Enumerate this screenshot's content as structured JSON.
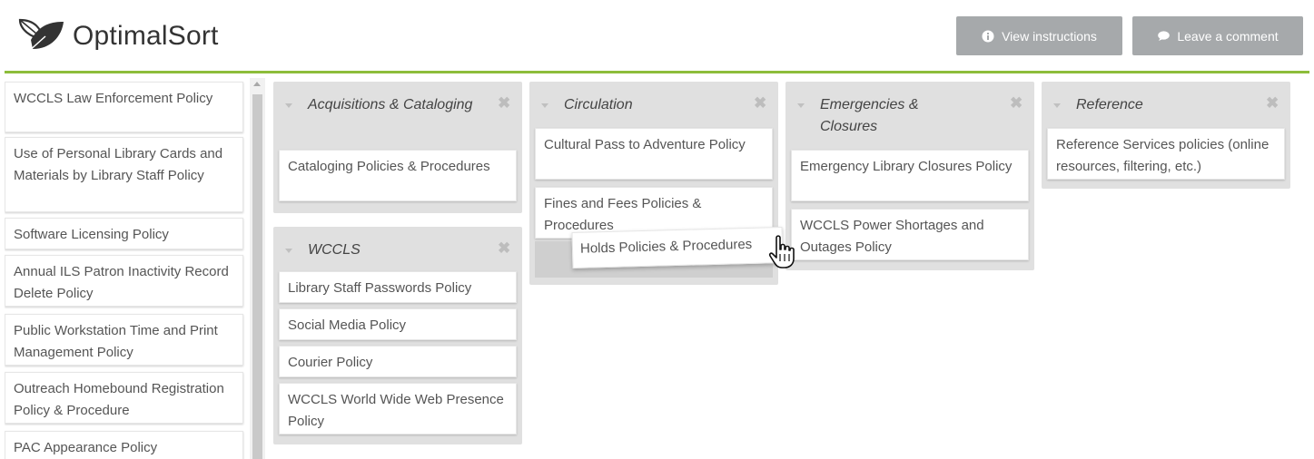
{
  "header": {
    "logo_text": "OptimalSort",
    "view_instructions_label": "View instructions",
    "leave_comment_label": "Leave a comment",
    "accent_color": "#8dbd3a",
    "button_color": "#a6a9ab"
  },
  "cards": [
    "WCCLS Law Enforcement Policy",
    "Use of Personal Library Cards and Materials by Library Staff Policy",
    "Software Licensing Policy",
    "Annual ILS Patron Inactivity Record Delete Policy",
    "Public Workstation Time and Print Management Policy",
    "Outreach Homebound Registration Policy & Procedure",
    "PAC Appearance Policy"
  ],
  "categories": {
    "acquisitions": {
      "title": "Acquisitions & Cataloging",
      "cards": [
        "Cataloging Policies & Procedures"
      ]
    },
    "wccls": {
      "title": "WCCLS",
      "cards": [
        "Library Staff Passwords Policy",
        "Social Media Policy",
        "Courier Policy",
        "WCCLS World Wide Web Presence Policy"
      ]
    },
    "circulation": {
      "title": "Circulation",
      "cards": [
        "Cultural Pass to Adventure Policy",
        "Fines and Fees Policies & Procedures"
      ]
    },
    "emergencies": {
      "title": "Emergencies & Closures",
      "cards": [
        "Emergency Library Closures Policy",
        "WCCLS Power Shortages and Outages Policy"
      ]
    },
    "reference": {
      "title": "Reference",
      "cards": [
        "Reference Services policies (online resources, filtering, etc.)"
      ]
    }
  },
  "dragging_card": "Holds Policies & Procedures",
  "icons": {
    "logo": "leaf-logo-icon",
    "info": "info-icon",
    "comment": "speech-bubble-icon",
    "collapse": "caret-down-icon",
    "close": "close-icon",
    "cursor": "hand-pointer-icon"
  }
}
